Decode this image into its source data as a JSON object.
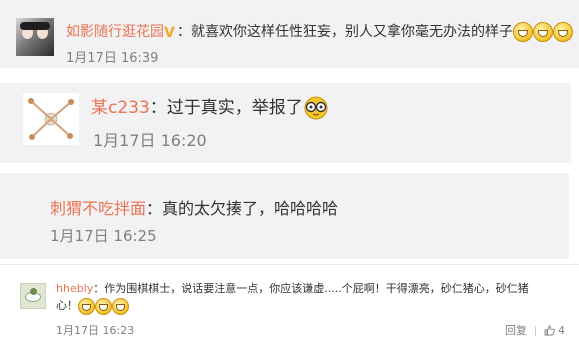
{
  "comments": [
    {
      "username": "如影随行逛花园",
      "badge": "V",
      "separator": "：",
      "text": "就喜欢你这样任性狂妄，别人又拿你毫无办法的样子",
      "emoji_count": 3,
      "emoji_name": "grin-emoji",
      "timestamp": "1月17日 16:39"
    },
    {
      "username": "某c233",
      "separator": "：",
      "text": "过于真实，举报了",
      "emoji_count": 1,
      "emoji_name": "glasses-emoji",
      "timestamp": "1月17日 16:20"
    },
    {
      "username": "刺猬不吃拌面",
      "separator": "：",
      "text": "真的太欠揍了，哈哈哈哈",
      "timestamp": "1月17日 16:25"
    },
    {
      "username": "hhebly",
      "separator": "：",
      "text_line1": "作为围棋棋士，说话要注意一点，你应该谦虚.....个屁啊！干得漂亮，砂仁猪心，砂仁猪",
      "text_line2": "心！",
      "emoji_count": 3,
      "emoji_name": "grin-emoji",
      "timestamp": "1月17日 16:23",
      "reply_label": "回复",
      "like_count": "4"
    }
  ],
  "colors": {
    "username": "#eb7350",
    "text": "#333333",
    "timestamp": "#808080",
    "panel": "#f2f2f5"
  }
}
